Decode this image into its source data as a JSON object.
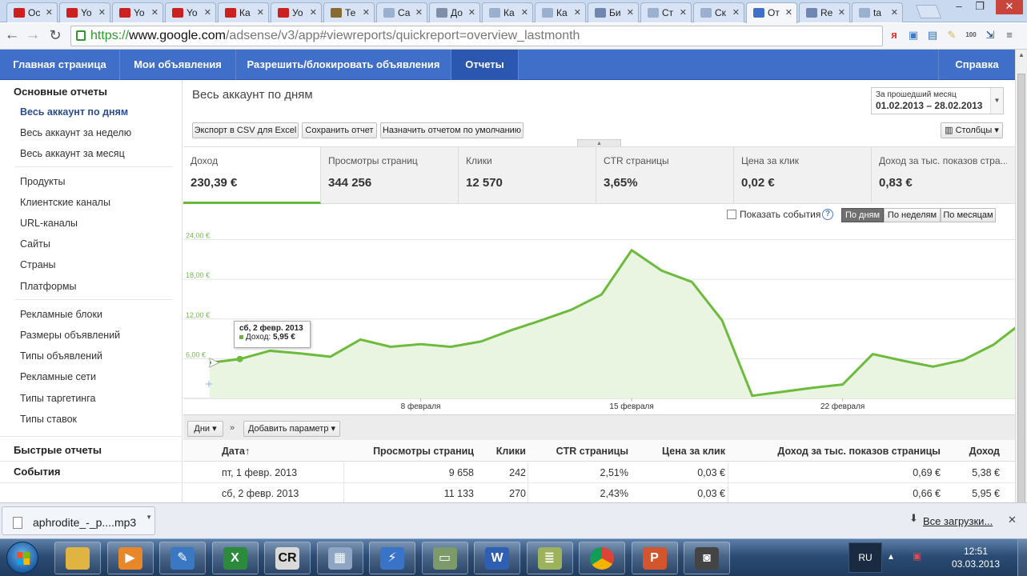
{
  "browser": {
    "tabs": [
      {
        "label": "Ос",
        "color": "#cc1f1f"
      },
      {
        "label": "Yo",
        "color": "#cc1f1f"
      },
      {
        "label": "Yo",
        "color": "#cc1f1f"
      },
      {
        "label": "Yo",
        "color": "#cc1f1f"
      },
      {
        "label": "Ка",
        "color": "#cc1f1f"
      },
      {
        "label": "Уо",
        "color": "#cc1f1f"
      },
      {
        "label": "Те",
        "color": "#8a6a2f"
      },
      {
        "label": "Са",
        "color": "#9bb0cf"
      },
      {
        "label": "До",
        "color": "#7f8fa8"
      },
      {
        "label": "Ка",
        "color": "#9bb0cf"
      },
      {
        "label": "Ка",
        "color": "#9bb0cf"
      },
      {
        "label": "Би",
        "color": "#6f86b0"
      },
      {
        "label": "Ст",
        "color": "#9bb0cf"
      },
      {
        "label": "Ск",
        "color": "#9bb0cf"
      },
      {
        "label": "От",
        "color": "#3f6fc8"
      },
      {
        "label": "Re",
        "color": "#6f86b0"
      },
      {
        "label": "ta",
        "color": "#9bb0cf"
      }
    ],
    "active_tab_index": 14,
    "url_scheme": "https://",
    "url_host": "www.google.com",
    "url_path": "/adsense/v3/app#viewreports/quickreport=overview_lastmonth",
    "extensions": [
      {
        "name": "yandex-bar-icon",
        "text": "я",
        "color": "#e0302a"
      },
      {
        "name": "translate-icon",
        "text": "▣",
        "color": "#3d7cc9"
      },
      {
        "name": "screen-icon",
        "text": "▤",
        "color": "#2c6eb0"
      },
      {
        "name": "notes-icon",
        "text": "✎",
        "color": "#d9b54a"
      },
      {
        "name": "counter-icon",
        "text": "100",
        "color": "#555555"
      },
      {
        "name": "extension-icon",
        "text": "⇲",
        "color": "#2e5a93"
      },
      {
        "name": "menu-icon",
        "text": "≡",
        "color": "#555555"
      }
    ]
  },
  "nav": {
    "items": [
      "Главная страница",
      "Мои объявления",
      "Разрешить/блокировать объявления",
      "Отчеты"
    ],
    "active": 3,
    "help": "Справка"
  },
  "sidebar": {
    "main_reports": "Основные отчеты",
    "group1": [
      "Весь аккаунт по дням",
      "Весь аккаунт за неделю",
      "Весь аккаунт за месяц"
    ],
    "group2": [
      "Продукты",
      "Клиентские каналы",
      "URL-каналы",
      "Сайты",
      "Страны",
      "Платформы"
    ],
    "group3": [
      "Рекламные блоки",
      "Размеры объявлений",
      "Типы объявлений",
      "Рекламные сети",
      "Типы таргетинга",
      "Типы ставок"
    ],
    "quick_reports": "Быстрые отчеты",
    "events": "События"
  },
  "report": {
    "title": "Весь аккаунт по дням",
    "date_caption": "За прошедший месяц",
    "date_range": "01.02.2013 – 28.02.2013",
    "buttons": {
      "export": "Экспорт в CSV для Excel",
      "save": "Сохранить отчет",
      "default": "Назначить отчетом по умолчанию",
      "columns": "Столбцы"
    }
  },
  "metrics": [
    {
      "label": "Доход",
      "value": "230,39 €"
    },
    {
      "label": "Просмотры страниц",
      "value": "344 256"
    },
    {
      "label": "Клики",
      "value": "12 570"
    },
    {
      "label": "CTR страницы",
      "value": "3,65%"
    },
    {
      "label": "Цена за клик",
      "value": "0,02 €"
    },
    {
      "label": "Доход за тыс. показов стра...",
      "value": "0,83 €"
    }
  ],
  "chart_controls": {
    "show_events": "Показать события",
    "help": "?",
    "by_day": "По дням",
    "by_week": "По неделям",
    "by_month": "По месяцам"
  },
  "chart_data": {
    "type": "area",
    "title": "",
    "xlabel": "",
    "ylabel": "",
    "x": [
      "1 февр.",
      "2 февр.",
      "3 февр.",
      "4 февр.",
      "5 февр.",
      "6 февр.",
      "7 февр.",
      "8 февр.",
      "9 февр.",
      "10 февр.",
      "11 февр.",
      "12 февр.",
      "13 февр.",
      "14 февр.",
      "15 февр.",
      "16 февр.",
      "17 февр.",
      "18 февр.",
      "19 февр.",
      "20 февр.",
      "21 февр.",
      "22 февр.",
      "23 февр.",
      "24 февр.",
      "25 февр.",
      "26 февр.",
      "27 февр.",
      "28 февр."
    ],
    "x_tick_labels": [
      {
        "index": 7,
        "label": "8 февраля"
      },
      {
        "index": 14,
        "label": "15 февраля"
      },
      {
        "index": 21,
        "label": "22 февраля"
      }
    ],
    "series": [
      {
        "values": [
          5.38,
          5.95,
          7.2,
          6.8,
          6.3,
          8.9,
          7.8,
          8.2,
          7.8,
          8.6,
          10.3,
          11.8,
          13.4,
          15.7,
          22.4,
          19.3,
          17.6,
          11.8,
          0.4,
          1.0,
          1.6,
          2.1,
          6.7,
          5.7,
          4.8,
          5.8,
          8.1,
          11.6
        ]
      }
    ],
    "y_ticks": [
      "6,00 €",
      "12,00 €",
      "18,00 €",
      "24,00 €"
    ],
    "ylim": [
      0,
      26
    ],
    "grid": true,
    "color": "#6dbb3c",
    "tooltip": {
      "title": "сб, 2 февр. 2013",
      "label": "Доход:",
      "value": "5,95 €",
      "index": 1
    }
  },
  "table_controls": {
    "dimension": "Дни",
    "separator": "»",
    "add_param": "Добавить параметр"
  },
  "table": {
    "headers": [
      "Дата",
      "Просмотры страниц",
      "Клики",
      "CTR страницы",
      "Цена за клик",
      "Доход за тыс. показов страницы",
      "Доход"
    ],
    "sort_indicator": "↑",
    "rows": [
      [
        "пт, 1 февр. 2013",
        "9 658",
        "242",
        "2,51%",
        "0,03 €",
        "0,69 €",
        "5,38 €"
      ],
      [
        "сб, 2 февр. 2013",
        "11 133",
        "270",
        "2,43%",
        "0,03 €",
        "0,66 €",
        "5,95 €"
      ]
    ]
  },
  "downloads": {
    "file": "aphrodite_-_p....mp3",
    "all": "Все загрузки..."
  },
  "taskbar": {
    "apps": [
      {
        "name": "explorer",
        "text": "",
        "color": "#e0b440"
      },
      {
        "name": "media-player",
        "text": "▶",
        "color": "#e8862a"
      },
      {
        "name": "tool",
        "text": "✎",
        "color": "#3b78c4"
      },
      {
        "name": "excel",
        "text": "X",
        "color": "#2c8a3c"
      },
      {
        "name": "cr",
        "text": "CR",
        "color": "#d9d9d9"
      },
      {
        "name": "calculator",
        "text": "▦",
        "color": "#8ea6c4"
      },
      {
        "name": "flash",
        "text": "⚡",
        "color": "#3a74c8"
      },
      {
        "name": "monitor",
        "text": "▭",
        "color": "#7d9a6a"
      },
      {
        "name": "word",
        "text": "W",
        "color": "#2f5fb3"
      },
      {
        "name": "stack",
        "text": "≣",
        "color": "#9cb25b"
      },
      {
        "name": "chrome",
        "text": "",
        "color": "#e0e0e0"
      },
      {
        "name": "powerpoint",
        "text": "P",
        "color": "#d2552d"
      },
      {
        "name": "camera",
        "text": "◙",
        "color": "#444444"
      }
    ],
    "lang": "RU",
    "time": "12:51",
    "date": "03.03.2013"
  }
}
